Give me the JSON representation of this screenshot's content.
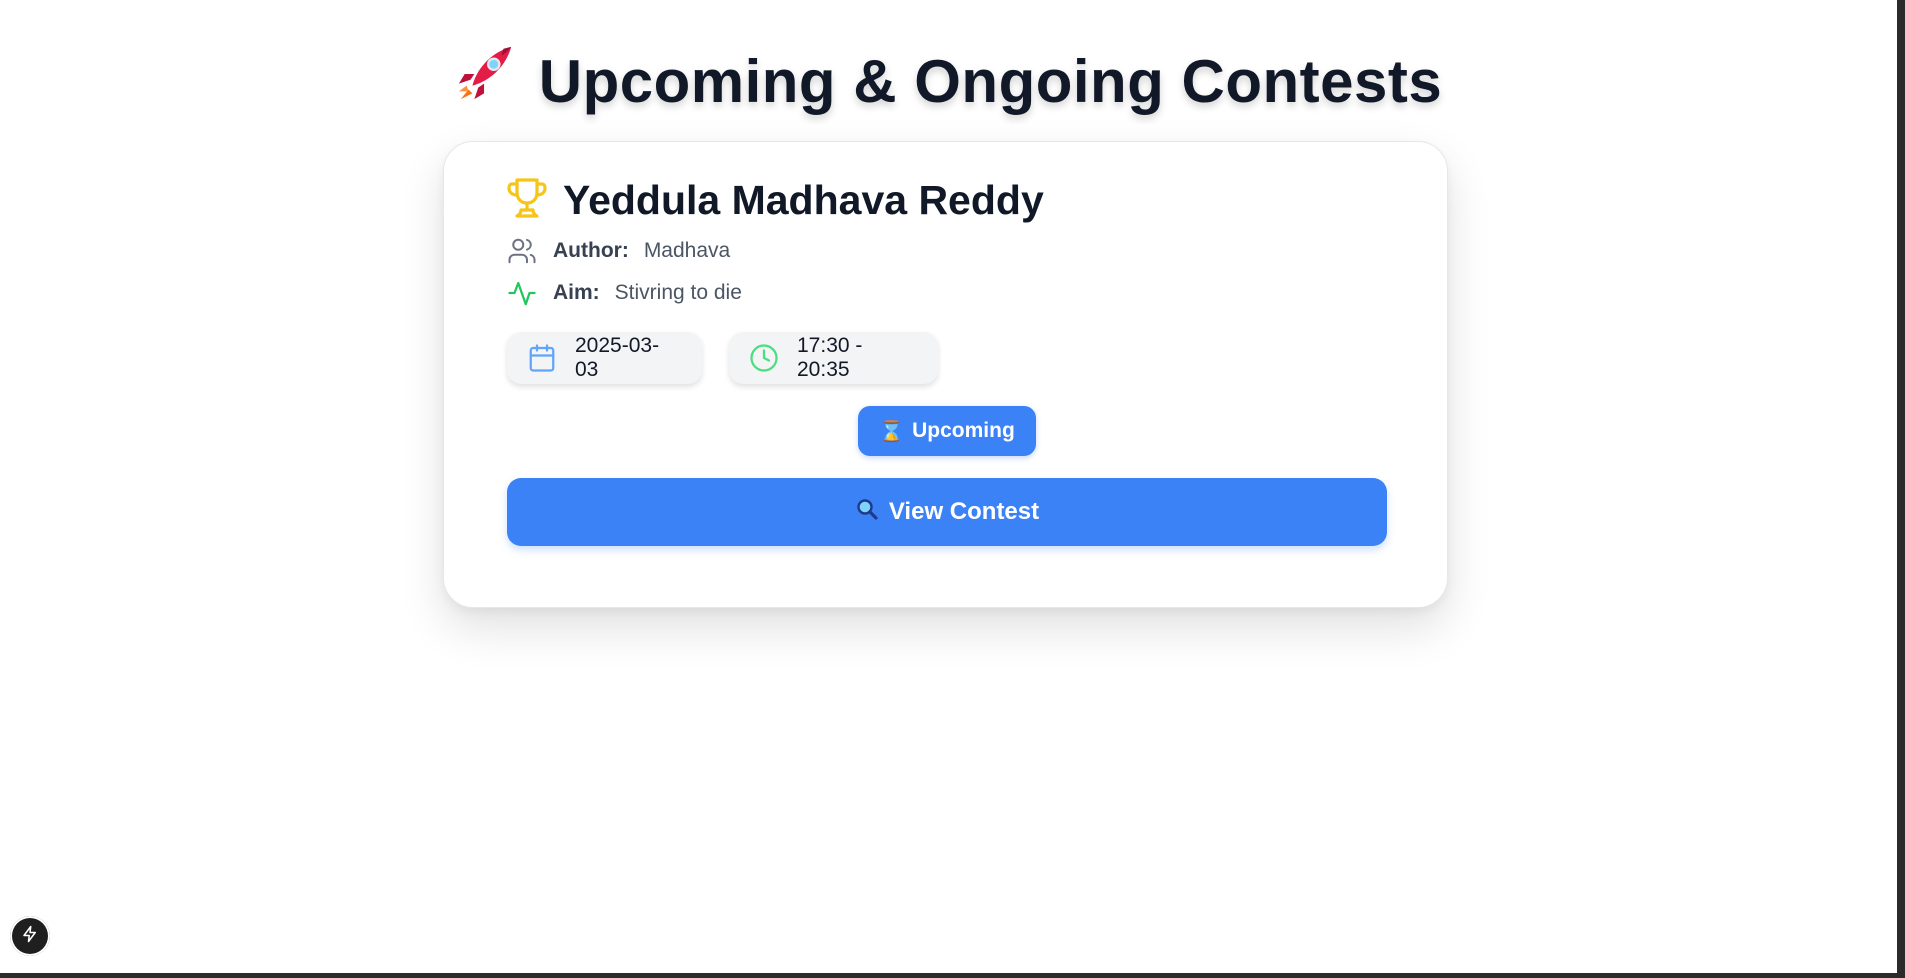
{
  "page": {
    "title": "Upcoming & Ongoing Contests",
    "title_icon": "rocket-icon"
  },
  "contest": {
    "title": "Yeddula Madhava Reddy",
    "title_icon": "trophy-icon",
    "author_label": "Author:",
    "author_value": "Madhava",
    "aim_label": "Aim:",
    "aim_value": "Stivring to die",
    "date": "2025-03-03",
    "time": "17:30 - 20:35",
    "status": "Upcoming",
    "status_icon": "hourglass-icon",
    "button_label": "View Contest",
    "button_icon": "magnifier-icon"
  },
  "colors": {
    "accent": "#3b82f6",
    "trophy": "#f5c518",
    "aim_icon": "#22c55e",
    "calendar_icon": "#60a5fa",
    "clock_icon": "#4ade80"
  },
  "dev_badge_icon": "lightning-icon"
}
